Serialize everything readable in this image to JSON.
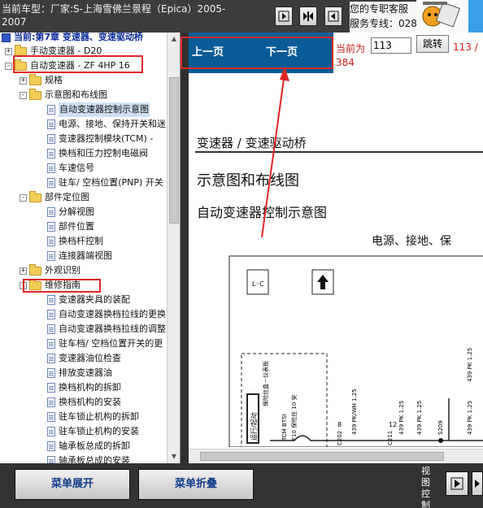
{
  "header": {
    "car_line1": "当前车型：厂家:S-上海雪佛兰景程（Epica）2005-",
    "car_line2": "2007",
    "service_line1": "您的专职客服",
    "service_line2": "服务专线：028"
  },
  "tree": {
    "chapter": "当前:第7章 变速器、变速驱动桥",
    "items": [
      {
        "label": "手动变速器 - D20"
      },
      {
        "label": "自动变速器 - ZF 4HP 16"
      },
      {
        "label": "规格"
      },
      {
        "label": "示意图和布线图"
      },
      {
        "label": "自动变速器控制示意图"
      },
      {
        "label": "电源、接地、保持开关和迷"
      },
      {
        "label": "变速器控制模块(TCM) -"
      },
      {
        "label": "换档和压力控制电磁阀"
      },
      {
        "label": "车速信号"
      },
      {
        "label": "驻车/ 空档位置(PNP) 开关"
      },
      {
        "label": "部件定位图"
      },
      {
        "label": "分解视图"
      },
      {
        "label": "部件位置"
      },
      {
        "label": "换档杆控制"
      },
      {
        "label": "连接器端视图"
      },
      {
        "label": "外观识别"
      },
      {
        "label": "维修指南"
      },
      {
        "label": "变速器夹具的装配"
      },
      {
        "label": "自动变速器换档拉线的更换"
      },
      {
        "label": "自动变速器换档拉线的调整"
      },
      {
        "label": "驻车档/ 空档位置开关的更"
      },
      {
        "label": "变速器油位检查"
      },
      {
        "label": "排放变速器油"
      },
      {
        "label": "换档机构的拆卸"
      },
      {
        "label": "换档机构的安装"
      },
      {
        "label": "驻车锁止机构的拆卸"
      },
      {
        "label": "驻车锁止机构的安装"
      },
      {
        "label": "轴承板总成的拆卸"
      },
      {
        "label": "轴承板总成的安装"
      }
    ]
  },
  "nav": {
    "prev": "上一页",
    "next": "下一页",
    "current_label": "当前为",
    "page_value": "113",
    "jump": "跳转",
    "total_part1": "113 /",
    "total_part2": "384"
  },
  "doc": {
    "section": "变速器 / 变速驱动桥",
    "heading": "示意图和布线图",
    "subheading": "自动变速器控制示意图",
    "circuit_title": "电源、接地、保",
    "diagram_labels": {
      "fuse_box": "保险丝盒－仪表板",
      "tcm": "TCM BTSI",
      "f10": "F10 保险丝 10 安",
      "run_start": "运行/起动",
      "c202": "C202",
      "pin8": "8",
      "pin12": "12",
      "c211": "C211",
      "s209": "S209",
      "wire1": "439 PK/WH 1.25",
      "wire2": "439 PK 1.25",
      "wire3": "439 PK 1.25",
      "wire4": "439 PK 1.25",
      "wire5": "439 PK 1.25"
    }
  },
  "footer": {
    "expand": "菜单展开",
    "collapse": "菜单折叠",
    "view_label": "视图控制"
  },
  "colors": {
    "nav_strip": "#0a5b97",
    "annotation": "#e02626",
    "page_numbers": "#d02020"
  }
}
